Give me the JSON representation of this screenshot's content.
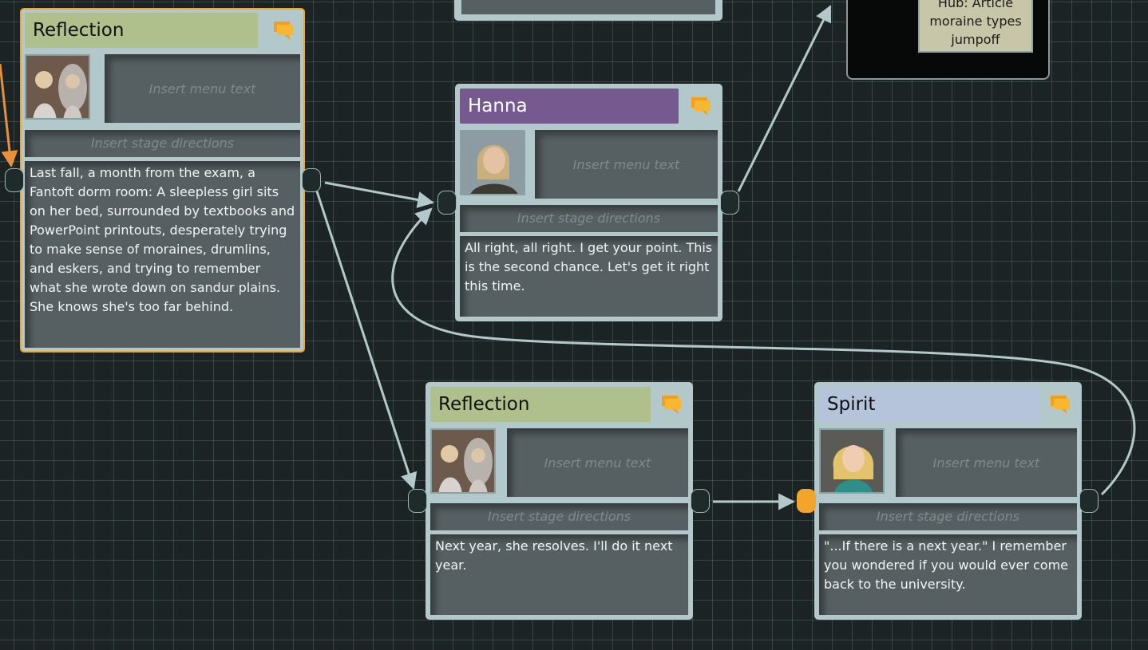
{
  "colors": {
    "canvas_bg": "#1b2324",
    "node_frame": "#b2c8ca",
    "selected_border": "#f2a52a",
    "reflection_title": "#afc08c",
    "hanna_title": "#76598f",
    "spirit_title": "#b5c4db",
    "text_field": "#566062",
    "placeholder_text": "#7f8a8c",
    "connection": "#b2c8ca",
    "incoming_connection": "#e8913a"
  },
  "nodes": {
    "reflection_1": {
      "title": "Reflection",
      "menu_text": "Insert menu text",
      "stage_directions": "Insert stage directions",
      "text": "Last fall, a month from the exam, a Fantoft dorm room: A sleepless girl sits on her bed, surrounded by textbooks and PowerPoint printouts, desperately trying to make sense of moraines, drumlins, and eskers, and trying to remember what she wrote down on sandur plains. She knows she's too far behind.",
      "icon": "speech-bubble-icon",
      "portrait": "girl-mirror-portrait"
    },
    "hanna": {
      "title": "Hanna",
      "menu_text": "Insert menu text",
      "stage_directions": "Insert stage directions",
      "text": "All right, all right. I get your point. This is the second chance. Let's get it right this time.",
      "icon": "speech-bubble-icon",
      "portrait": "hanna-portrait"
    },
    "reflection_2": {
      "title": "Reflection",
      "menu_text": "Insert menu text",
      "stage_directions": "Insert stage directions",
      "text": "Next year, she resolves. I'll do it next year.",
      "icon": "speech-bubble-icon",
      "portrait": "girl-mirror-portrait"
    },
    "spirit": {
      "title": "Spirit",
      "menu_text": "Insert menu text",
      "stage_directions": "Insert stage directions",
      "text": "\"...If there is a next year.\" I remember you wondered if you would ever come back to the university.",
      "icon": "speech-bubble-icon",
      "portrait": "spirit-portrait"
    }
  },
  "hub": {
    "label": "Hub: Article moraine types jumpoff"
  }
}
